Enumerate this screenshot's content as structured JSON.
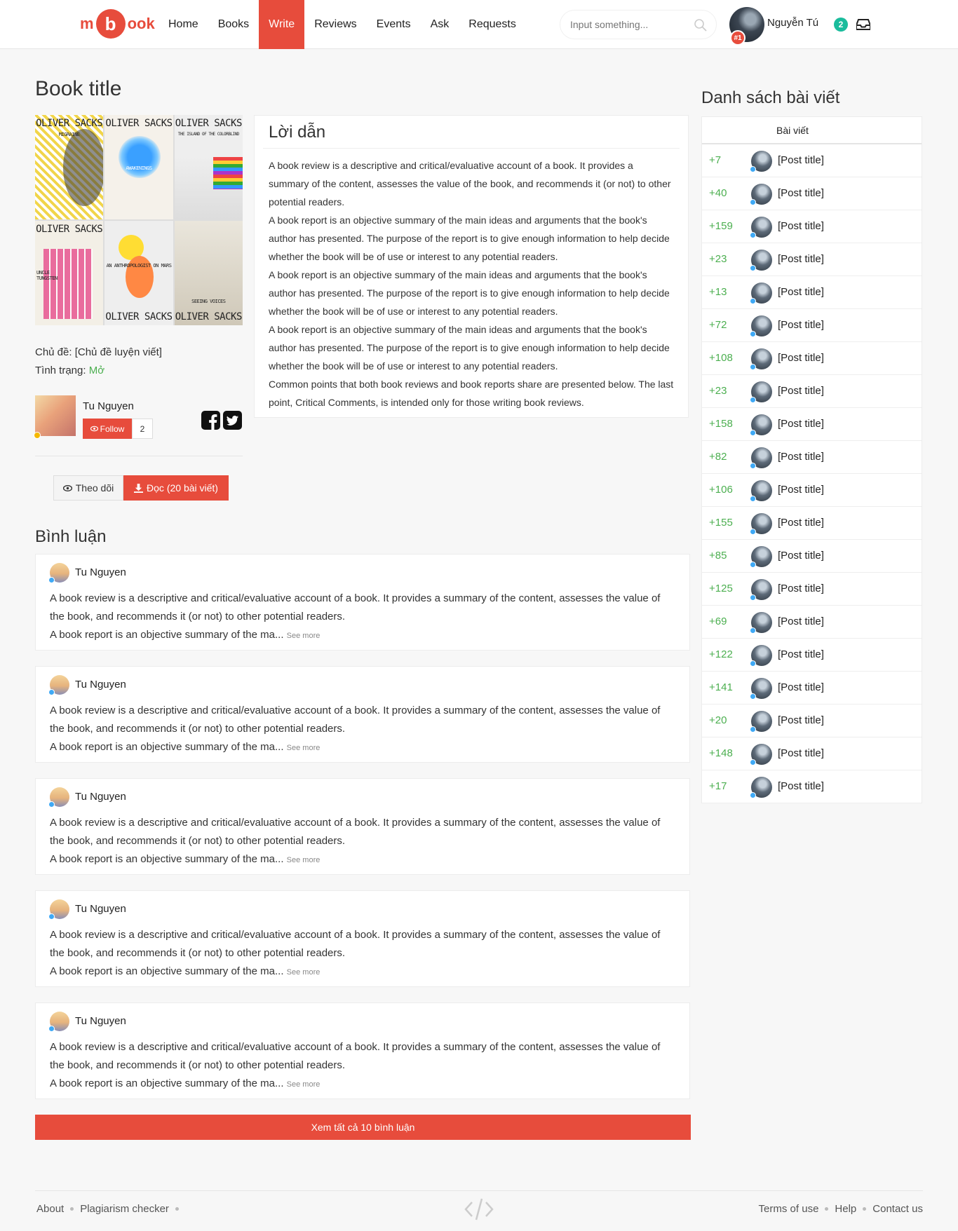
{
  "brand": {
    "logo_left": "m",
    "logo_circle": "b",
    "logo_right": "ook",
    "accent_color": "#e74c3c"
  },
  "nav": {
    "items": [
      {
        "label": "Home",
        "active": false
      },
      {
        "label": "Books",
        "active": false
      },
      {
        "label": "Write",
        "active": true
      },
      {
        "label": "Reviews",
        "active": false
      },
      {
        "label": "Events",
        "active": false
      },
      {
        "label": "Ask",
        "active": false
      },
      {
        "label": "Requests",
        "active": false
      }
    ],
    "search_placeholder": "Input something...",
    "user_name": "Nguyễn Tú",
    "user_rank": "#1",
    "notification_count": "2"
  },
  "book": {
    "title": "Book title",
    "cover_author": "OLIVER SACKS",
    "cover_titles": [
      "MIGRAINE",
      "AWAKENINGS",
      "THE ISLAND OF THE COLORBLIND",
      "UNCLE TUNGSTEN",
      "AN ANTHROPOLOGIST ON MARS",
      "SEEING VOICES"
    ],
    "topic_label": "Chủ đề:",
    "topic_value": "[Chủ đề luyện viết]",
    "status_label": "Tình trạng:",
    "status_value": "Mở",
    "author_name": "Tu Nguyen",
    "follow_label": "Follow",
    "follow_count": "2",
    "watch_label": "Theo dõi",
    "read_label": "Đọc (20 bài viết)"
  },
  "intro": {
    "heading": "Lời dẫn",
    "paragraphs": [
      "A book review is a descriptive and critical/evaluative account of a book. It provides a summary of the content, assesses the value of the book, and recommends it (or not) to other potential readers.",
      "A book report is an objective summary of the main ideas and arguments that the book's author has presented. The purpose of the report is to give enough information to help decide whether the book will be of use or interest to any potential readers.",
      "A book report is an objective summary of the main ideas and arguments that the book's author has presented. The purpose of the report is to give enough information to help decide whether the book will be of use or interest to any potential readers.",
      "A book report is an objective summary of the main ideas and arguments that the book's author has presented. The purpose of the report is to give enough information to help decide whether the book will be of use or interest to any potential readers.",
      "Common points that both book reviews and book reports share are presented below. The last point, Critical Comments, is intended only for those writing book reviews."
    ]
  },
  "comments": {
    "heading": "Bình luận",
    "items": [
      {
        "author": "Tu Nguyen",
        "line1": "A book review is a descriptive and critical/evaluative account of a book. It provides a summary of the content, assesses the value of the book, and recommends it (or not) to other potential readers.",
        "line2": "A book report is an objective summary of the ma...",
        "see_more": "See more"
      },
      {
        "author": "Tu Nguyen",
        "line1": "A book review is a descriptive and critical/evaluative account of a book. It provides a summary of the content, assesses the value of the book, and recommends it (or not) to other potential readers.",
        "line2": "A book report is an objective summary of the ma...",
        "see_more": "See more"
      },
      {
        "author": "Tu Nguyen",
        "line1": "A book review is a descriptive and critical/evaluative account of a book. It provides a summary of the content, assesses the value of the book, and recommends it (or not) to other potential readers.",
        "line2": "A book report is an objective summary of the ma...",
        "see_more": "See more"
      },
      {
        "author": "Tu Nguyen",
        "line1": "A book review is a descriptive and critical/evaluative account of a book. It provides a summary of the content, assesses the value of the book, and recommends it (or not) to other potential readers.",
        "line2": "A book report is an objective summary of the ma...",
        "see_more": "See more"
      },
      {
        "author": "Tu Nguyen",
        "line1": "A book review is a descriptive and critical/evaluative account of a book. It provides a summary of the content, assesses the value of the book, and recommends it (or not) to other potential readers.",
        "line2": "A book report is an objective summary of the ma...",
        "see_more": "See more"
      }
    ],
    "all_label": "Xem tất cả 10 bình luận"
  },
  "sidebar": {
    "heading": "Danh sách bài viết",
    "column_header": "Bài viết",
    "posts": [
      {
        "score": "+7",
        "title": "[Post title]"
      },
      {
        "score": "+40",
        "title": "[Post title]"
      },
      {
        "score": "+159",
        "title": "[Post title]"
      },
      {
        "score": "+23",
        "title": "[Post title]"
      },
      {
        "score": "+13",
        "title": "[Post title]"
      },
      {
        "score": "+72",
        "title": "[Post title]"
      },
      {
        "score": "+108",
        "title": "[Post title]"
      },
      {
        "score": "+23",
        "title": "[Post title]"
      },
      {
        "score": "+158",
        "title": "[Post title]"
      },
      {
        "score": "+82",
        "title": "[Post title]"
      },
      {
        "score": "+106",
        "title": "[Post title]"
      },
      {
        "score": "+155",
        "title": "[Post title]"
      },
      {
        "score": "+85",
        "title": "[Post title]"
      },
      {
        "score": "+125",
        "title": "[Post title]"
      },
      {
        "score": "+69",
        "title": "[Post title]"
      },
      {
        "score": "+122",
        "title": "[Post title]"
      },
      {
        "score": "+141",
        "title": "[Post title]"
      },
      {
        "score": "+20",
        "title": "[Post title]"
      },
      {
        "score": "+148",
        "title": "[Post title]"
      },
      {
        "score": "+17",
        "title": "[Post title]"
      }
    ]
  },
  "footer": {
    "left_links": [
      "About",
      "Plagiarism checker"
    ],
    "right_links": [
      "Terms of use",
      "Help",
      "Contact us"
    ]
  }
}
